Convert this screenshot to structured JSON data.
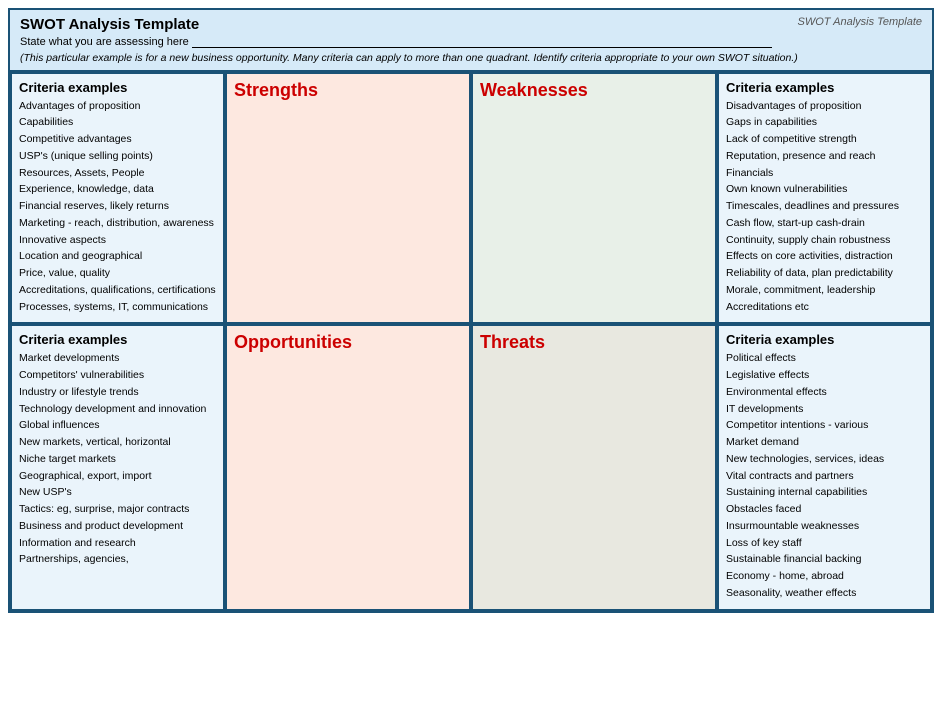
{
  "header": {
    "title": "SWOT Analysis Template",
    "watermark": "SWOT Analysis Template",
    "state_label": "State what you are assessing  here",
    "italic_note": "(This particular example is for a new business opportunity.  Many criteria can apply to more than one quadrant.  Identify criteria appropriate to your own SWOT situation.)"
  },
  "top_left_criteria": {
    "heading": "Criteria examples",
    "items": [
      "Advantages of proposition",
      "Capabilities",
      "Competitive advantages",
      "USP's (unique selling points)",
      "Resources, Assets, People",
      "Experience, knowledge, data",
      "Financial reserves, likely returns",
      "Marketing - reach, distribution, awareness",
      "Innovative aspects",
      "Location and geographical",
      "Price, value, quality",
      "Accreditations, qualifications, certifications",
      "Processes, systems, IT, communications"
    ]
  },
  "strengths": {
    "heading": "Strengths"
  },
  "weaknesses": {
    "heading": "Weaknesses"
  },
  "top_right_criteria": {
    "heading": "Criteria examples",
    "items": [
      "Disadvantages of proposition",
      "Gaps in capabilities",
      "Lack of competitive strength",
      "Reputation, presence and reach",
      "Financials",
      "Own known vulnerabilities",
      "Timescales, deadlines and pressures",
      "Cash flow,  start-up cash-drain",
      "Continuity, supply chain robustness",
      "Effects on core activities, distraction",
      "Reliability of data, plan predictability",
      "Morale, commitment, leadership",
      "Accreditations etc"
    ]
  },
  "bot_left_criteria": {
    "heading": "Criteria examples",
    "items": [
      "Market developments",
      "Competitors' vulnerabilities",
      "Industry or lifestyle trends",
      "Technology development and innovation",
      "Global influences",
      "New markets, vertical, horizontal",
      "Niche target markets",
      "Geographical, export, import",
      "New USP's",
      "Tactics: eg, surprise, major contracts",
      "Business and product development",
      "Information and research",
      "Partnerships, agencies,"
    ]
  },
  "opportunities": {
    "heading": "Opportunities"
  },
  "threats": {
    "heading": "Threats"
  },
  "bot_right_criteria": {
    "heading": "Criteria examples",
    "items": [
      "Political effects",
      "Legislative effects",
      "Environmental effects",
      "IT developments",
      "Competitor intentions - various",
      "Market demand",
      "New technologies, services, ideas",
      "Vital contracts and partners",
      "Sustaining internal capabilities",
      "Obstacles faced",
      "Insurmountable weaknesses",
      "Loss of key staff",
      "Sustainable financial backing",
      "Economy - home, abroad",
      "Seasonality, weather effects"
    ]
  }
}
